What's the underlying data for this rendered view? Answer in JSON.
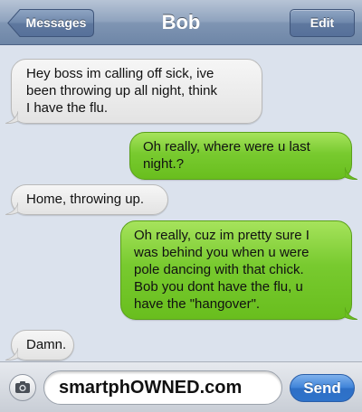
{
  "navbar": {
    "back_label": "Messages",
    "title": "Bob",
    "edit_label": "Edit"
  },
  "messages": [
    {
      "direction": "received",
      "lines": [
        "Hey boss im calling off sick, ive",
        "been throwing up all night, think",
        "I have the flu."
      ]
    },
    {
      "direction": "sent",
      "lines": [
        "Oh really, where were u last",
        "night.?"
      ]
    },
    {
      "direction": "received",
      "lines": [
        "Home, throwing up."
      ]
    },
    {
      "direction": "sent",
      "lines": [
        "Oh really, cuz im pretty sure I",
        "was behind you when u were",
        "pole dancing with that chick.",
        "Bob you dont have the flu, u",
        "have the \"hangover\"."
      ]
    },
    {
      "direction": "received",
      "lines": [
        "Damn."
      ]
    }
  ],
  "input": {
    "camera_icon": "camera-icon",
    "text_value": "smartphOWNED.com",
    "send_label": "Send"
  },
  "colors": {
    "sent_bubble": "#78ca2f",
    "received_bubble": "#ececec",
    "navbar": "#8fa3be",
    "background": "#dbe2ed",
    "send_button": "#3d82d8"
  }
}
